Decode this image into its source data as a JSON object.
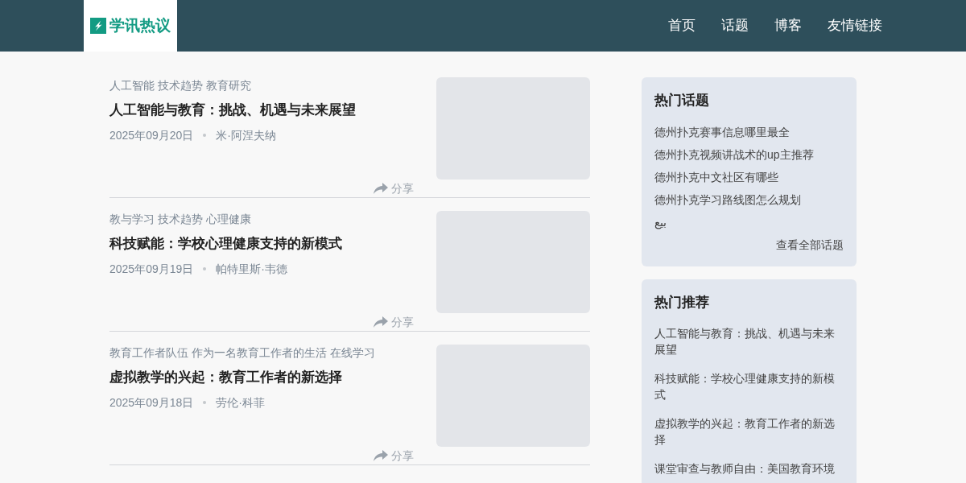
{
  "header": {
    "logo_text": "学讯热议",
    "nav": [
      {
        "label": "首页"
      },
      {
        "label": "话题"
      },
      {
        "label": "博客"
      },
      {
        "label": "友情链接"
      }
    ]
  },
  "articles": [
    {
      "tags": "人工智能 技术趋势 教育研究",
      "title": "人工智能与教育：挑战、机遇与未来展望",
      "date": "2025年09月20日",
      "author": "米·阿涅夫纳",
      "share": "分享"
    },
    {
      "tags": "教与学习 技术趋势 心理健康",
      "title": "科技赋能：学校心理健康支持的新模式",
      "date": "2025年09月19日",
      "author": "帕特里斯·韦德",
      "share": "分享"
    },
    {
      "tags": "教育工作者队伍 作为一名教育工作者的生活 在线学习",
      "title": "虚拟教学的兴起：教育工作者的新选择",
      "date": "2025年09月18日",
      "author": "劳伦·科菲",
      "share": "分享"
    }
  ],
  "hot_topics": {
    "title": "热门话题",
    "items": [
      "德州扑克赛事信息哪里最全",
      "德州扑克视频讲战术的up主推荐",
      "德州扑克中文社区有哪些",
      "德州扑克学习路线图怎么规划",
      "بيع"
    ],
    "more": "查看全部话题"
  },
  "recommended": {
    "title": "热门推荐",
    "items": [
      "人工智能与教育：挑战、机遇与未来展望",
      "科技赋能：学校心理健康支持的新模式",
      "虚拟教学的兴起：教育工作者的新选择",
      "课堂审查与教师自由：美国教育环境"
    ]
  }
}
